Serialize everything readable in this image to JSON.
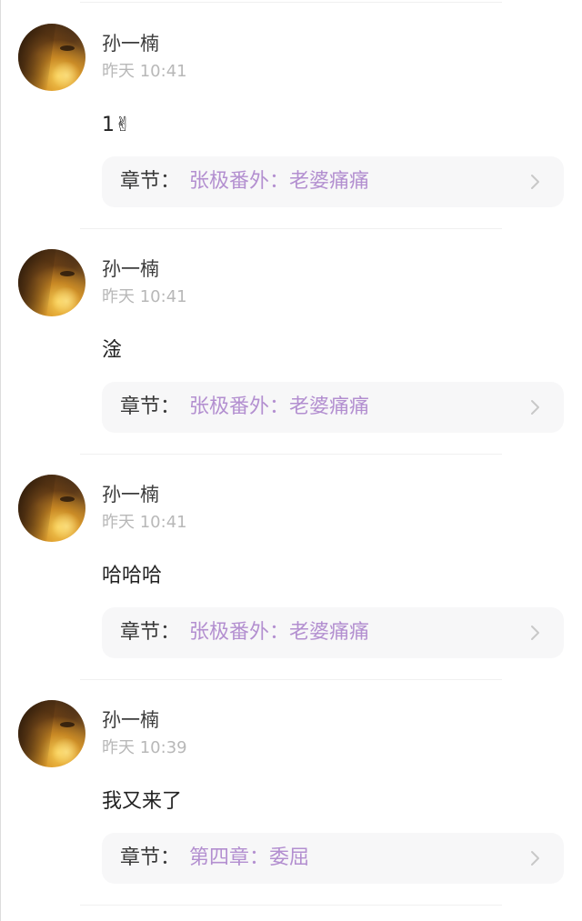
{
  "comments": [
    {
      "username": "孙一楠",
      "timestamp": "昨天 10:41",
      "content": "1✌",
      "chapter_prefix": "章节：",
      "chapter_title": "张极番外：老婆痛痛"
    },
    {
      "username": "孙一楠",
      "timestamp": "昨天 10:41",
      "content": "淦",
      "chapter_prefix": "章节：",
      "chapter_title": "张极番外：老婆痛痛"
    },
    {
      "username": "孙一楠",
      "timestamp": "昨天 10:41",
      "content": "哈哈哈",
      "chapter_prefix": "章节：",
      "chapter_title": "张极番外：老婆痛痛"
    },
    {
      "username": "孙一楠",
      "timestamp": "昨天 10:39",
      "content": "我又来了",
      "chapter_prefix": "章节：",
      "chapter_title": "第四章：委屈"
    }
  ],
  "colors": {
    "chapter_title": "#b38fd0",
    "username": "#3c3c3c",
    "timestamp": "#b8b8b8",
    "card_background": "#f7f7f8"
  },
  "icons": {
    "avatar": "user-avatar-photo",
    "chevron": "chevron-right-icon"
  }
}
